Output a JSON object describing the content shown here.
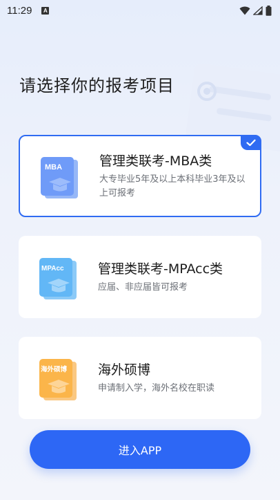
{
  "status_bar": {
    "time": "11:29",
    "icons": [
      "notification-a-icon",
      "wifi-icon",
      "signal-icon",
      "battery-icon"
    ]
  },
  "page": {
    "title": "请选择你的报考项目"
  },
  "options": [
    {
      "icon_label": "MBA",
      "title": "管理类联考-MBA类",
      "description": "大专毕业5年及以上本科毕业3年及以上可报考",
      "selected": true,
      "color": "#5a8cf7"
    },
    {
      "icon_label": "MPAcc",
      "title": "管理类联考-MPAcc类",
      "description": "应届、非应届皆可报考",
      "selected": false,
      "color": "#4fb0f4"
    },
    {
      "icon_label": "海外硕博",
      "title": "海外硕博",
      "description": "申请制入学，海外名校在职读",
      "selected": false,
      "color": "#f8a93a"
    }
  ],
  "enter_button": {
    "label": "进入APP"
  },
  "colors": {
    "accent": "#2f6bf2",
    "button": "#2d67f5"
  }
}
